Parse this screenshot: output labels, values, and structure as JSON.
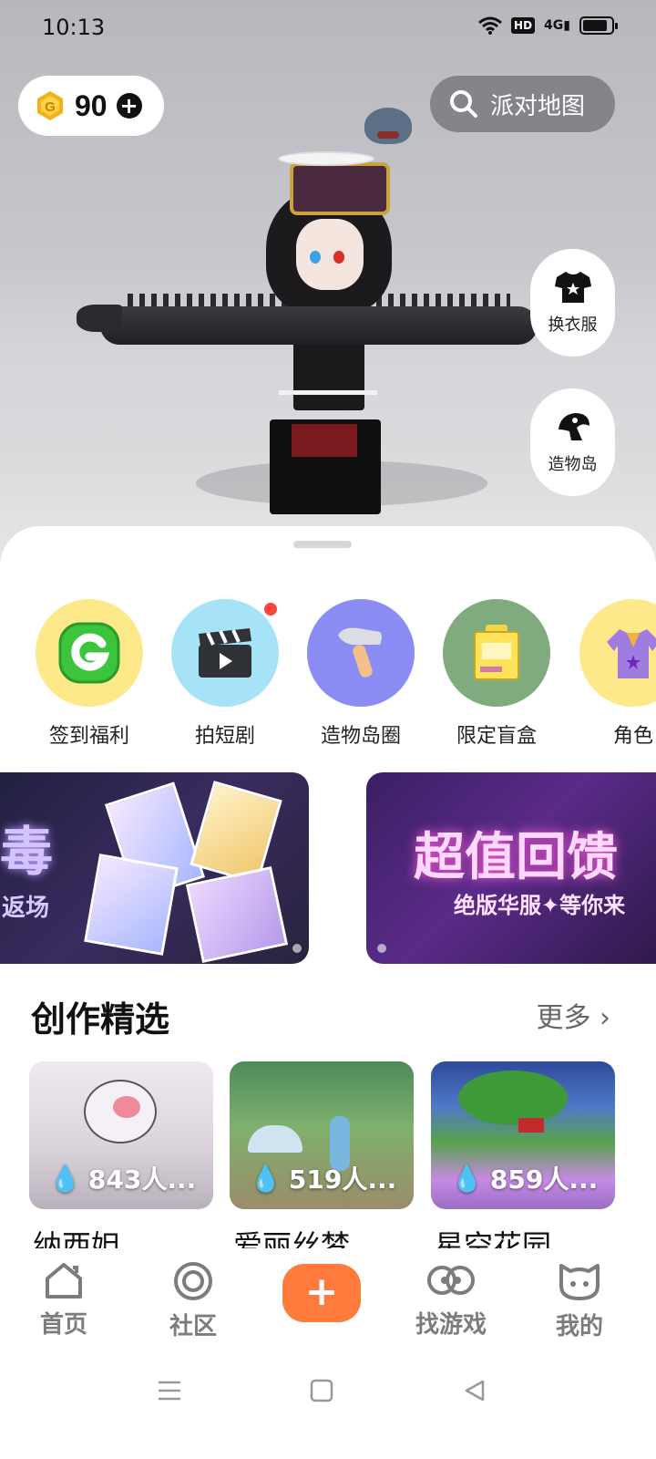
{
  "status_bar": {
    "time": "10:13",
    "hd": "HD",
    "network": "4G"
  },
  "currency": {
    "value": "90",
    "icon": "g-coin-icon",
    "plus": "+"
  },
  "search": {
    "label": "派对地图"
  },
  "side_buttons": [
    {
      "label": "换衣服",
      "icon": "tshirt-icon"
    },
    {
      "label": "造物岛",
      "icon": "island-icon"
    }
  ],
  "quick_actions": [
    {
      "label": "签到福利",
      "icon": "g-checkin-icon",
      "bg": "#fde98a",
      "badge": false
    },
    {
      "label": "拍短剧",
      "icon": "clapperboard-icon",
      "bg": "#a7e3f7",
      "badge": true
    },
    {
      "label": "造物岛圈",
      "icon": "hammer-icon",
      "bg": "#8b8df5",
      "badge": false
    },
    {
      "label": "限定盲盒",
      "icon": "blind-box-icon",
      "bg": "#7fab7e",
      "badge": false
    },
    {
      "label": "角色",
      "icon": "outfit-icon",
      "bg": "#fde98a",
      "badge": false
    }
  ],
  "banners": [
    {
      "title": "毒",
      "subtitle": "返场"
    },
    {
      "title": "超值回馈",
      "subtitle": "绝版华服✦等你来"
    }
  ],
  "section": {
    "title": "创作精选",
    "more": "更多"
  },
  "creations": [
    {
      "count": "843人...",
      "title": "纳西妲"
    },
    {
      "count": "519人...",
      "title": "爱丽丝梦"
    },
    {
      "count": "859人...",
      "title": "星空花园"
    }
  ],
  "bottom_nav": [
    {
      "label": "首页",
      "icon": "home-icon"
    },
    {
      "label": "社区",
      "icon": "community-icon"
    },
    {
      "label": "+",
      "icon": "create-icon"
    },
    {
      "label": "找游戏",
      "icon": "find-game-icon"
    },
    {
      "label": "我的",
      "icon": "profile-icon"
    }
  ],
  "colors": {
    "accent": "#ff7a3d",
    "badge": "#ff4440",
    "coin": "#f2b21b"
  }
}
